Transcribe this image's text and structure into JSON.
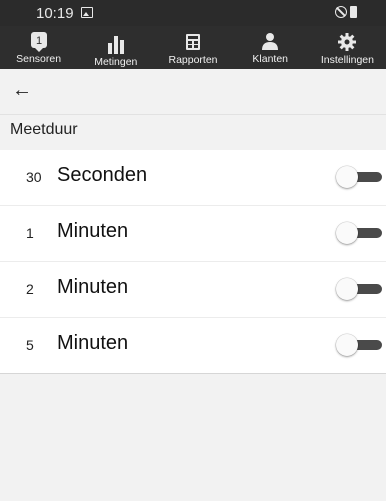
{
  "status_bar": {
    "time": "10:19"
  },
  "tabs": [
    {
      "label": "Sensoren",
      "icon": "sensor-badge-icon",
      "badge": "1"
    },
    {
      "label": "Metingen",
      "icon": "bar-chart-icon"
    },
    {
      "label": "Rapporten",
      "icon": "report-icon"
    },
    {
      "label": "Klanten",
      "icon": "people-icon"
    },
    {
      "label": "Instellingen",
      "icon": "gear-icon"
    }
  ],
  "toolbar": {
    "back_icon": "arrow-left-icon",
    "back_glyph": "←"
  },
  "section": {
    "title": "Meetduur"
  },
  "options": [
    {
      "number": "30",
      "unit": "Seconden",
      "enabled": false
    },
    {
      "number": "1",
      "unit": "Minuten",
      "enabled": false
    },
    {
      "number": "2",
      "unit": "Minuten",
      "enabled": false
    },
    {
      "number": "5",
      "unit": "Minuten",
      "enabled": false
    }
  ],
  "colors": {
    "bar_background": "#2e2e2e",
    "panel_background": "#f2f2f2",
    "toggle_track": "#4a4a4a"
  }
}
